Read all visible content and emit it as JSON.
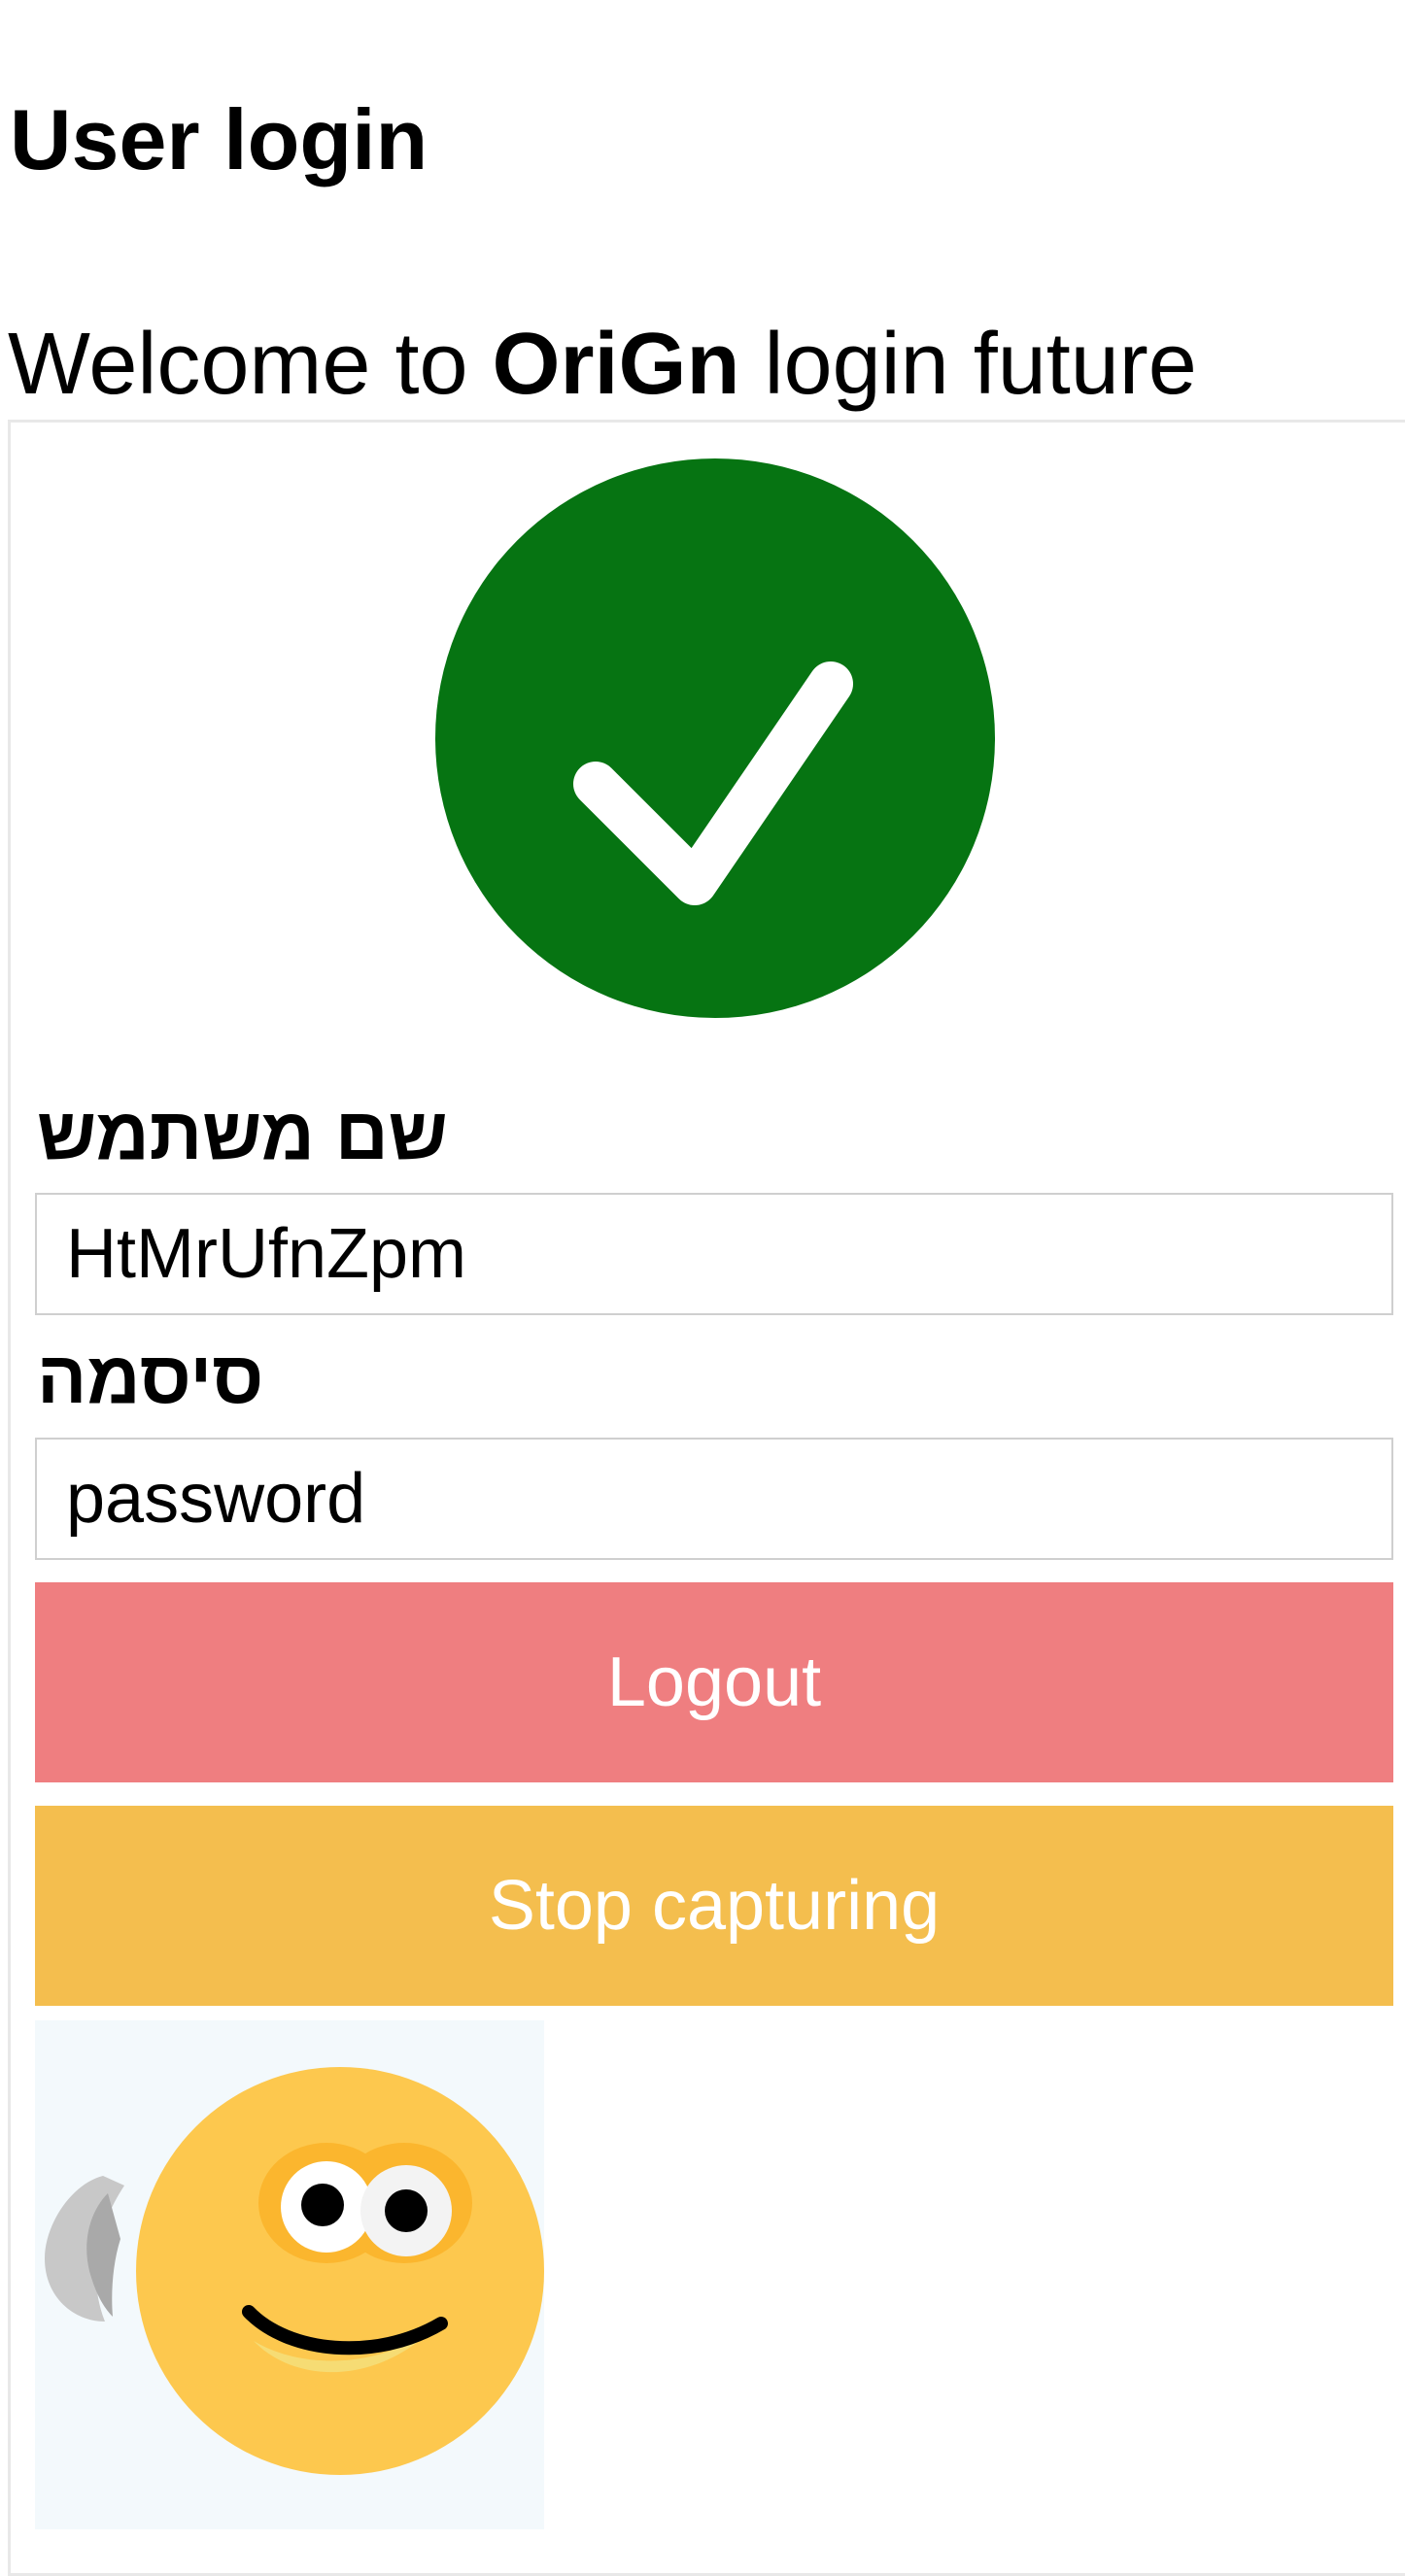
{
  "header": {
    "title": "User login"
  },
  "welcome": {
    "prefix": "Welcome to ",
    "brand": "OriGn",
    "suffix": " login future"
  },
  "status": {
    "icon": "check-circle-icon",
    "color": "#067412"
  },
  "form": {
    "username_label": "שם משתמש",
    "username_value": "HtMrUfnZpm",
    "password_label": "סיסמה",
    "password_value": "password"
  },
  "buttons": {
    "logout_label": "Logout",
    "logout_color": "#ef7e80",
    "stop_label": "Stop capturing",
    "stop_color": "#f4be4e"
  },
  "capture": {
    "icon": "smiley-face-icon"
  }
}
